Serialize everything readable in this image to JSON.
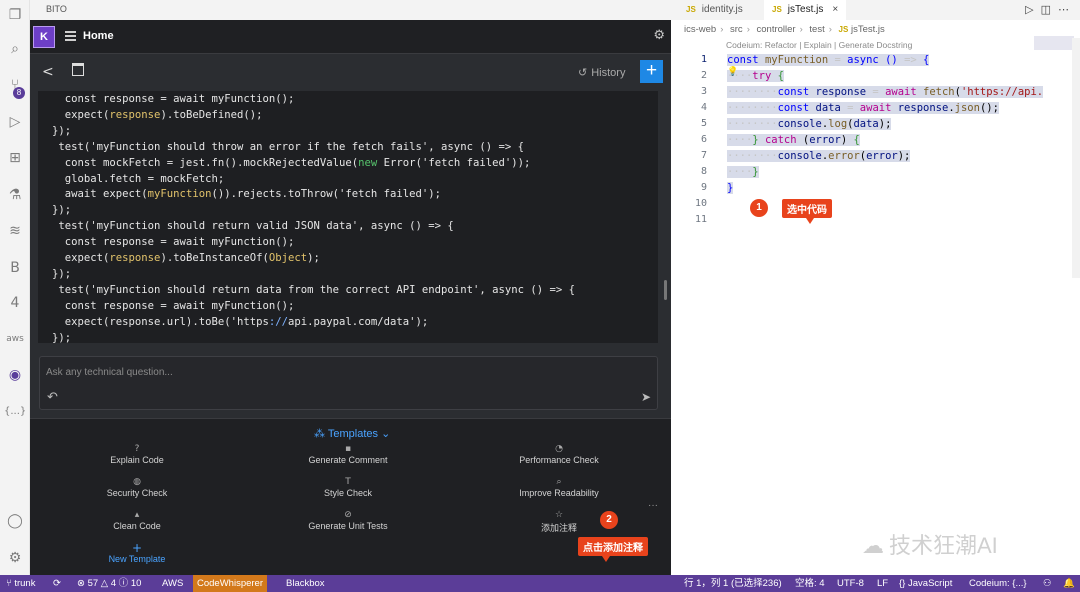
{
  "app": {
    "title": "BITO"
  },
  "activity_bar": {
    "items": [
      "files-icon",
      "search-icon",
      "source-control-icon",
      "run-debug-icon",
      "extensions-icon",
      "testing-icon",
      "git-lens-icon",
      "b-icon",
      "4-icon",
      "aws-icon",
      "bito-icon",
      "json-icon",
      "account-icon",
      "settings-icon"
    ],
    "source_control_badge": "8"
  },
  "bito": {
    "avatar": "K",
    "header": {
      "title": "Home"
    },
    "toolbar": {
      "history": "History",
      "new": "+"
    },
    "code_lines": [
      [
        "  const response = await myFunction();"
      ],
      [
        "  expect(",
        {
          "t": "response",
          "c": "y"
        },
        ").toBeDefined();"
      ],
      [
        "});"
      ],
      [
        " test('myFunction should throw an error if the fetch fails', async () => {"
      ],
      [
        "  const mockFetch = jest.fn().mockRejectedValue(",
        {
          "t": "new",
          "c": "g"
        },
        " Error('fetch failed'));"
      ],
      [
        "  global.fetch = mockFetch;"
      ],
      [
        "  await expect(",
        {
          "t": "myFunction",
          "c": "y"
        },
        "()).rejects.toThrow('fetch failed');"
      ],
      [
        "});"
      ],
      [
        " test('myFunction should return valid JSON data', async () => {"
      ],
      [
        "  const response = await myFunction();"
      ],
      [
        "  expect(",
        {
          "t": "response",
          "c": "y"
        },
        ").toBeInstanceOf(",
        {
          "t": "Object",
          "c": "y"
        },
        ");"
      ],
      [
        "});"
      ],
      [
        " test('myFunction should return data from the correct API endpoint', async () => {"
      ],
      [
        "  const response = await myFunction();"
      ],
      [
        "  expect(response.url).toBe('https",
        {
          "t": "://",
          "c": "b"
        },
        "api.paypal.com/data');"
      ],
      [
        "});"
      ]
    ],
    "ask": {
      "placeholder": "Ask any technical question..."
    },
    "templates": {
      "title": "Templates",
      "items": [
        {
          "label": "Explain Code",
          "icon": "?"
        },
        {
          "label": "Generate Comment",
          "icon": "▪"
        },
        {
          "label": "Performance Check",
          "icon": "◔"
        },
        {
          "label": "Security Check",
          "icon": "◍"
        },
        {
          "label": "Style Check",
          "icon": "T"
        },
        {
          "label": "Improve Readability",
          "icon": "⌕"
        },
        {
          "label": "Clean Code",
          "icon": "▴"
        },
        {
          "label": "Generate Unit Tests",
          "icon": "⊘"
        },
        {
          "label": "添加注释",
          "icon": "☆"
        }
      ],
      "new_template": "New Template",
      "more": "···"
    }
  },
  "editor": {
    "tabs": [
      {
        "label": "identity.js",
        "icon": "JS",
        "active": false
      },
      {
        "label": "jsTest.js",
        "icon": "JS",
        "active": true,
        "close": "×"
      }
    ],
    "breadcrumb": [
      "ics-web",
      "src",
      "controller",
      "test",
      "jsTest.js"
    ],
    "codelens": "Codeium: Refactor | Explain | Generate Docstring",
    "line_numbers": [
      "1",
      "2",
      "3",
      "4",
      "5",
      "6",
      "7",
      "8",
      "9",
      "10",
      "11"
    ],
    "annotations": [
      {
        "number": "1",
        "text": "选中代码"
      },
      {
        "number": "2",
        "text": "点击添加注释"
      }
    ]
  },
  "watermark": "技术狂潮AI",
  "status_bar": {
    "branch": "trunk",
    "problems": "⊗ 57 △ 4 ⓘ 10",
    "aws": "AWS",
    "codewhisperer": "CodeWhisperer",
    "blackbox": "Blackbox",
    "position": "行 1，列 1 (已选择236)",
    "spaces": "空格: 4",
    "encoding": "UTF-8",
    "eol": "LF",
    "language": "JavaScript",
    "codeium": "Codeium: {...}"
  },
  "colors": {
    "accent": "#1e88e5",
    "status_bar": "#5b3d98",
    "annotation": "#e8431c",
    "codewhisperer": "#d3791b"
  }
}
